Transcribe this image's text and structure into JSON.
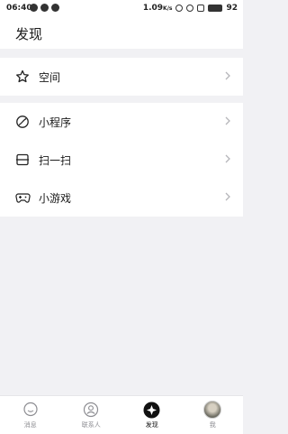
{
  "status_bar": {
    "time": "06:40",
    "speed": "1.09",
    "speed_unit": "K/s",
    "battery": "92"
  },
  "header": {
    "title": "发现"
  },
  "group1": [
    {
      "label": "空间",
      "icon": "star-icon"
    }
  ],
  "group2": [
    {
      "label": "小程序",
      "icon": "mini-program-icon"
    },
    {
      "label": "扫一扫",
      "icon": "scan-icon"
    },
    {
      "label": "小游戏",
      "icon": "gamepad-icon"
    }
  ],
  "tabs": [
    {
      "label": "消息",
      "icon": "message-icon"
    },
    {
      "label": "联系人",
      "icon": "contacts-icon"
    },
    {
      "label": "发现",
      "icon": "discover-icon",
      "active": true
    },
    {
      "label": "我",
      "icon": "avatar"
    }
  ],
  "colors": {
    "background": "#f1f1f4",
    "active": "#111111",
    "inactive": "#8d8d92"
  }
}
